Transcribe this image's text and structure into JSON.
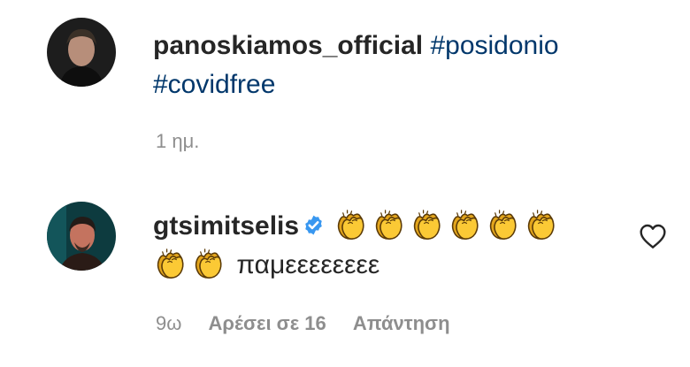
{
  "post_caption": {
    "username": "panoskiamos_official",
    "hashtags": [
      "#posidonio",
      "#covidfree"
    ],
    "time": "1 ημ."
  },
  "comment": {
    "username": "gtsimitselis",
    "verified": true,
    "emoji_icon": "clapping-hands-icon",
    "clap_count_line1": 6,
    "clap_count_line2": 2,
    "text": "παμεεεεεεεε",
    "time": "9ω",
    "likes_label": "Αρέσει σε 16",
    "reply_label": "Απάντηση"
  },
  "colors": {
    "username": "#262626",
    "hashtag": "#00376b",
    "meta": "#8e8e8e",
    "verified": "#3897f0"
  }
}
